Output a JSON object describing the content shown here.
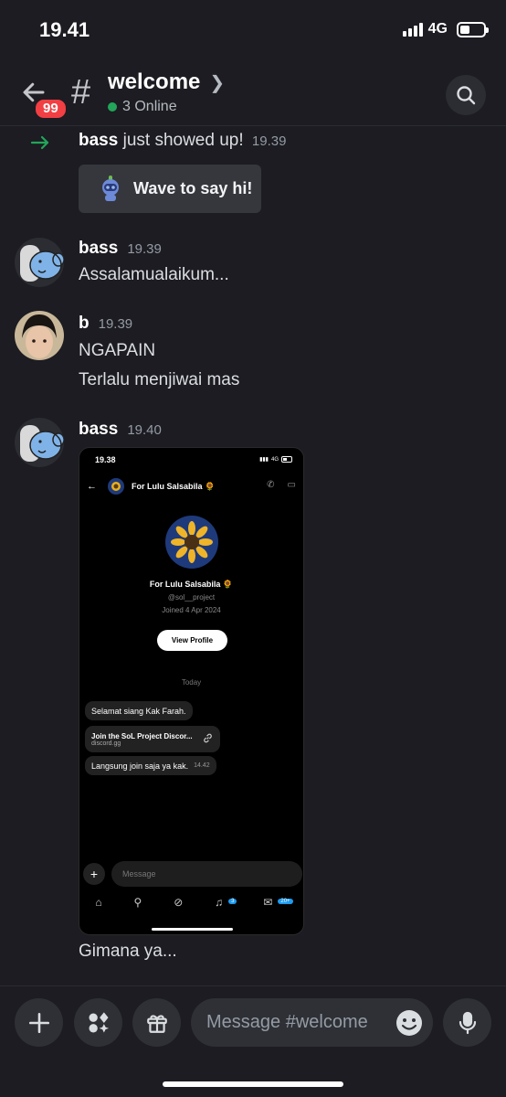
{
  "status": {
    "time": "19.41",
    "network": "4G"
  },
  "header": {
    "badge": "99",
    "hash": "#",
    "channel": "welcome",
    "online": "3 Online"
  },
  "system_message": {
    "user": "bass",
    "text": "just showed up!",
    "time": "19.39",
    "wave_label": "Wave to say hi!"
  },
  "messages": [
    {
      "author": "bass",
      "time": "19.39",
      "lines": [
        "Assalamualaikum..."
      ]
    },
    {
      "author": "b",
      "time": "19.39",
      "lines": [
        "NGAPAIN",
        "Terlalu menjiwai mas"
      ]
    },
    {
      "author": "bass",
      "time": "19.40",
      "lines": [
        "Gimana ya..."
      ]
    }
  ],
  "embed": {
    "time": "19.38",
    "network": "4G",
    "title": "For Lulu Salsabila 🌻",
    "profile_name": "For Lulu Salsabila 🌻",
    "handle": "@sol__project",
    "joined": "Joined 4 Apr 2024",
    "view_profile": "View Profile",
    "today": "Today",
    "bubbles": {
      "greeting": "Selamat siang Kak Farah.",
      "link_title": "Join the SoL Project Discor...",
      "link_url": "discord.gg",
      "join": "Langsung join saja ya kak.",
      "join_time": "14.42"
    },
    "compose_placeholder": "Message",
    "nav_badges": {
      "notifications": "3",
      "messages": "20+"
    }
  },
  "composer": {
    "placeholder": "Message #welcome"
  },
  "colors": {
    "background": "#1c1c22",
    "online": "#23a55a",
    "badge": "#f23f43",
    "join_arrow": "#23a55a"
  }
}
